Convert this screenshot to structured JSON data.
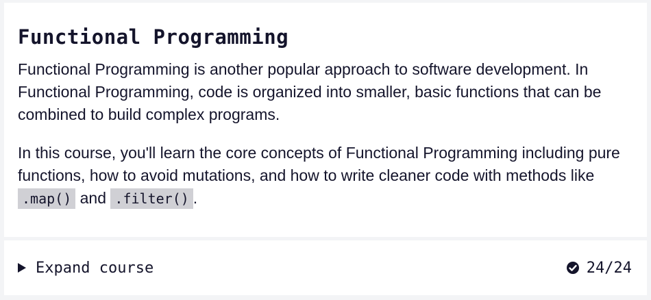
{
  "title": "Functional Programming",
  "paragraph1": "Functional Programming is another popular approach to software development. In Functional Programming, code is organized into smaller, basic functions that can be combined to build complex programs.",
  "paragraph2": {
    "text_before": "In this course, you'll learn the core concepts of Functional Programming including pure functions, how to avoid mutations, and how to write cleaner code with methods like ",
    "code1": ".map()",
    "text_middle": " and ",
    "code2": ".filter()",
    "text_after": "."
  },
  "footer": {
    "expand_label": "Expand course",
    "expand_icon": "caret-right-icon",
    "progress_icon": "check-circle-icon",
    "progress": "24/24",
    "lessons_completed": 24,
    "lessons_total": 24
  }
}
